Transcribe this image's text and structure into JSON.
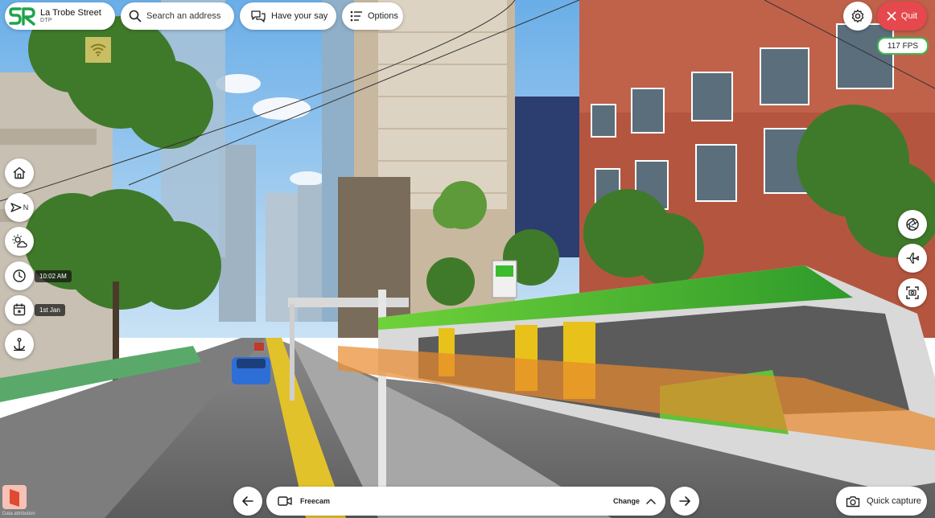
{
  "app": {
    "location_title": "La Trobe Street",
    "location_subtitle": "DTP",
    "logo_text": "SR"
  },
  "top_bar": {
    "search_placeholder": "Search an address",
    "feedback_label": "Have your say",
    "options_label": "Options",
    "quit_label": "Quit",
    "fps_label": "117 FPS"
  },
  "left_toolbar": {
    "compass_label": "N",
    "time_label": "10:02 AM",
    "date_label": "1st Jan"
  },
  "bottom_bar": {
    "mode_label": "Freecam",
    "change_label": "Change",
    "quick_capture_label": "Quick capture",
    "attribution_label": "Data attribution"
  },
  "colors": {
    "accent_quit": "#e5484d",
    "fps_border": "#3fb950",
    "brand_green": "#1fa34a",
    "tram_green": "#3dbb2f",
    "tram_yellow": "#e8c21a",
    "sky": "#8ec3ef"
  },
  "icons": {
    "search": "search-icon",
    "feedback": "chat-bubbles-icon",
    "options": "list-filter-icon",
    "settings": "gear-icon",
    "quit": "close-icon",
    "home": "home-icon",
    "compass": "compass-arrow-icon",
    "weather": "sun-cloud-icon",
    "time": "clock-icon",
    "date": "calendar-icon",
    "anchor": "anchor-icon",
    "aperture": "aperture-icon",
    "flight": "plane-icon",
    "screenshot": "focus-frame-icon",
    "prev": "arrow-left-icon",
    "next": "arrow-right-icon",
    "camera": "video-camera-icon",
    "chevron": "chevron-up-icon",
    "capture": "camera-icon",
    "wifi": "wifi-icon"
  }
}
